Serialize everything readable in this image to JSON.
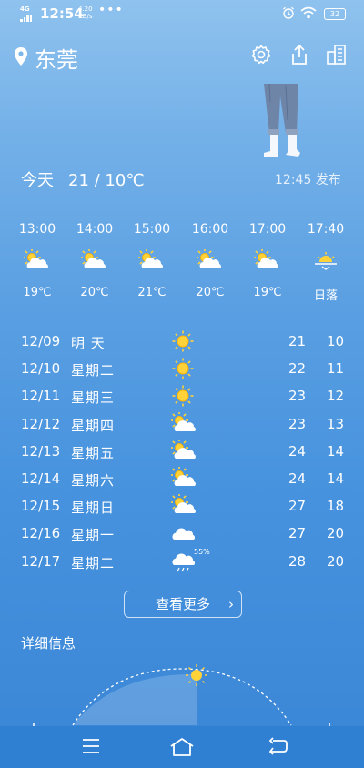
{
  "status_bar": {
    "network": "4G",
    "time": "12:54",
    "speed_value": "4.20",
    "speed_unit": "KB/s",
    "dots": "•••",
    "battery": "32"
  },
  "header": {
    "city": "东莞",
    "icons": [
      "location-pin-icon",
      "settings-gear-icon",
      "share-icon",
      "city-manage-icon"
    ]
  },
  "today": {
    "label": "今天",
    "range": "21 / 10℃",
    "published": "12:45 发布"
  },
  "hourly": [
    {
      "time": "13:00",
      "icon": "partly-cloudy-icon",
      "temp": "19℃"
    },
    {
      "time": "14:00",
      "icon": "partly-cloudy-icon",
      "temp": "20℃"
    },
    {
      "time": "15:00",
      "icon": "partly-cloudy-icon",
      "temp": "21℃"
    },
    {
      "time": "16:00",
      "icon": "partly-cloudy-icon",
      "temp": "20℃"
    },
    {
      "time": "17:00",
      "icon": "partly-cloudy-icon",
      "temp": "19℃"
    },
    {
      "time": "17:40",
      "icon": "sunset-icon",
      "temp": "日落"
    }
  ],
  "daily": [
    {
      "date": "12/09",
      "weekday": "明  天",
      "icon": "sunny-icon",
      "high": "21",
      "low": "10",
      "prob": ""
    },
    {
      "date": "12/10",
      "weekday": "星期二",
      "icon": "sunny-icon",
      "high": "22",
      "low": "11",
      "prob": ""
    },
    {
      "date": "12/11",
      "weekday": "星期三",
      "icon": "sunny-icon",
      "high": "23",
      "low": "12",
      "prob": ""
    },
    {
      "date": "12/12",
      "weekday": "星期四",
      "icon": "partly-cloudy-icon",
      "high": "23",
      "low": "13",
      "prob": ""
    },
    {
      "date": "12/13",
      "weekday": "星期五",
      "icon": "partly-cloudy-icon",
      "high": "24",
      "low": "14",
      "prob": ""
    },
    {
      "date": "12/14",
      "weekday": "星期六",
      "icon": "partly-cloudy-icon",
      "high": "24",
      "low": "14",
      "prob": ""
    },
    {
      "date": "12/15",
      "weekday": "星期日",
      "icon": "partly-cloudy-icon",
      "high": "27",
      "low": "18",
      "prob": ""
    },
    {
      "date": "12/16",
      "weekday": "星期一",
      "icon": "cloudy-icon",
      "high": "27",
      "low": "20",
      "prob": ""
    },
    {
      "date": "12/17",
      "weekday": "星期二",
      "icon": "rain-icon",
      "high": "28",
      "low": "20",
      "prob": "55%"
    }
  ],
  "more_button": {
    "label": "查看更多",
    "chevron": "›"
  },
  "details": {
    "title": "详细信息"
  },
  "colors": {
    "sun": "#ffd23a",
    "sun_core": "#ffb400",
    "cloud": "#ffffff",
    "nav_bar": "#2f7fd3"
  }
}
